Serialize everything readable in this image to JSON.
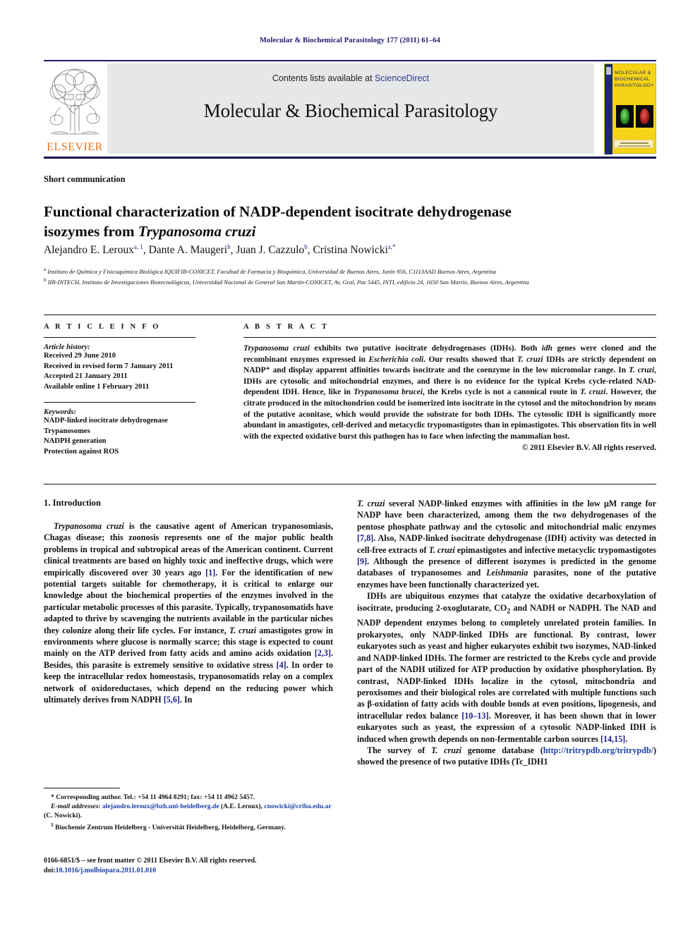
{
  "running_head": "Molecular & Biochemical Parasitology 177 (2011) 61–64",
  "masthead": {
    "publisher_name": "ELSEVIER",
    "contents_prefix": "Contents lists available at ",
    "sciencedirect": "ScienceDirect",
    "journal_title": "Molecular & Biochemical Parasitology",
    "cover_title": "MOLECULAR & BIOCHEMICAL PARASITOLOGY"
  },
  "article": {
    "doc_type": "Short communication",
    "title_line1": "Functional characterization of NADP-dependent isocitrate dehydrogenase",
    "title_line2_pre": "isozymes from ",
    "title_line2_italic": "Trypanosoma cruzi",
    "authors": [
      {
        "name": "Alejandro E. Leroux",
        "sup": "a, 1",
        "sep": ", "
      },
      {
        "name": "Dante A. Maugeri",
        "sup": "b",
        "sep": ", "
      },
      {
        "name": "Juan J. Cazzulo",
        "sup": "b",
        "sep": ", "
      },
      {
        "name": "Cristina Nowicki",
        "sup": "a,*",
        "sep": ""
      }
    ],
    "affiliations": [
      {
        "marker": "a",
        "text": "Instituto de Química y Fisicoquímica Biológica IQUIFIB-CONICET, Facultad de Farmacia y Bioquímica, Universidad de Buenos Aires, Junín 956, C1113AAD Buenos Aires, Argentina"
      },
      {
        "marker": "b",
        "text": "IIB-INTECH, Instituto de Investigaciones Biotecnológicas, Universidad Nacional de General San Martín-CONICET, Av, Gral, Paz 5445, INTI, edificio 24, 1650 San Martín, Buenos Aires, Argentina"
      }
    ]
  },
  "article_info": {
    "label": "A R T I C L E    I N F O",
    "history_title": "Article history:",
    "history": [
      "Received 29 June 2010",
      "Received in revised form 7 January 2011",
      "Accepted 21 January 2011",
      "Available online 1 February 2011"
    ],
    "keywords_title": "Keywords:",
    "keywords": [
      "NADP-linked isocitrate dehydrogenase",
      "Trypanosomes",
      "NADPH generation",
      "Protection against ROS"
    ]
  },
  "abstract": {
    "label": "A B S T R A C T",
    "copyright": "© 2011 Elsevier B.V. All rights reserved.",
    "parts": [
      {
        "type": "i",
        "text": "Trypanosoma cruzi"
      },
      {
        "type": "t",
        "text": " exhibits two putative isocitrate dehydrogenases (IDHs). Both "
      },
      {
        "type": "i",
        "text": "idh"
      },
      {
        "type": "t",
        "text": " genes were cloned and the recombinant enzymes expressed in "
      },
      {
        "type": "i",
        "text": "Escherichia coli"
      },
      {
        "type": "t",
        "text": ". Our results showed that "
      },
      {
        "type": "i",
        "text": "T. cruzi"
      },
      {
        "type": "t",
        "text": " IDHs are strictly dependent on NADP⁺ and display apparent affinities towards isocitrate and the coenzyme in the low micromolar range. In "
      },
      {
        "type": "i",
        "text": "T. cruzi"
      },
      {
        "type": "t",
        "text": ", IDHs are cytosolic and mitochondrial enzymes, and there is no evidence for the typical Krebs cycle-related NAD-dependent IDH. Hence, like in "
      },
      {
        "type": "i",
        "text": "Trypanosoma brucei"
      },
      {
        "type": "t",
        "text": ", the Krebs cycle is not a canonical route in "
      },
      {
        "type": "i",
        "text": "T. cruzi"
      },
      {
        "type": "t",
        "text": ". However, the citrate produced in the mitochondrion could be isomerized into isocitrate in the cytosol and the mitochondrion by means of the putative aconitase, which would provide the substrate for both IDHs. The cytosolic IDH is significantly more abundant in amastigotes, cell-derived and metacyclic trypomastigotes than in epimastigotes. This observation fits in well with the expected oxidative burst this pathogen has to face when infecting the mammalian host."
      }
    ]
  },
  "body": {
    "section_heading": "1.  Introduction",
    "left_paragraph_parts": [
      {
        "type": "i",
        "text": "Trypanosoma cruzi"
      },
      {
        "type": "t",
        "text": " is the causative agent of American trypanosomiasis, Chagas disease; this zoonosis represents one of the major public health problems in tropical and subtropical areas of the American continent. Current clinical treatments are based on highly toxic and ineffective drugs, which were empirically discovered over 30 years ago "
      },
      {
        "type": "r",
        "text": "[1]"
      },
      {
        "type": "t",
        "text": ". For the identification of new potential targets suitable for chemotherapy, it is critical to enlarge our knowledge about the biochemical properties of the enzymes involved in the particular metabolic processes of this parasite. Typically, trypanosomatids have adapted to thrive by scavenging the nutrients available in the particular niches they colonize along their life cycles. For instance, "
      },
      {
        "type": "i",
        "text": "T. cruzi"
      },
      {
        "type": "t",
        "text": " amastigotes grow in environments where glucose is normally scarce; this stage is expected to count mainly on the ATP derived from fatty acids and amino acids oxidation "
      },
      {
        "type": "r",
        "text": "[2,3]"
      },
      {
        "type": "t",
        "text": ". Besides, this parasite is extremely sensitive to oxidative stress "
      },
      {
        "type": "r",
        "text": "[4]"
      },
      {
        "type": "t",
        "text": ". In order to keep the intracellular redox homeostasis, trypanosomatids relay on a complex network of oxidoreductases, which depend on the reducing power which ultimately derives from NADPH "
      },
      {
        "type": "r",
        "text": "[5,6]"
      },
      {
        "type": "t",
        "text": ". In"
      }
    ],
    "right_paragraph1_parts": [
      {
        "type": "i",
        "text": "T. cruzi"
      },
      {
        "type": "t",
        "text": " several NADP-linked enzymes with affinities in the low μM range for NADP have been characterized, among them the two dehydrogenases of the pentose phosphate pathway and the cytosolic and mitochondrial malic enzymes "
      },
      {
        "type": "r",
        "text": "[7,8]"
      },
      {
        "type": "t",
        "text": ". Also, NADP-linked isocitrate dehydrogenase (IDH) activity was detected in cell-free extracts of "
      },
      {
        "type": "i",
        "text": "T. cruzi"
      },
      {
        "type": "t",
        "text": " epimastigotes and infective metacyclic trypomastigotes "
      },
      {
        "type": "r",
        "text": "[9]"
      },
      {
        "type": "t",
        "text": ". Although the presence of different isozymes is predicted in the genome databases of trypanosomes and "
      },
      {
        "type": "i",
        "text": "Leishmania"
      },
      {
        "type": "t",
        "text": " parasites, none of the putative enzymes have been functionally characterized yet."
      }
    ],
    "right_paragraph2_parts": [
      {
        "type": "t",
        "text": "IDHs are ubiquitous enzymes that catalyze the oxidative decarboxylation of isocitrate, producing 2-oxoglutarate, CO"
      },
      {
        "type": "sub",
        "text": "2"
      },
      {
        "type": "t",
        "text": " and NADH or NADPH. The NAD and NADP dependent enzymes belong to completely unrelated protein families. In prokaryotes, only NADP-linked IDHs are functional. By contrast, lower eukaryotes such as yeast and higher eukaryotes exhibit two isozymes, NAD-linked and NADP-linked IDHs. The former are restricted to the Krebs cycle and provide part of the NADH utilized for ATP production by oxidative phosphorylation. By contrast, NADP-linked IDHs localize in the cytosol, mitochondria and peroxisomes and their biological roles are correlated with multiple functions such as β-oxidation of fatty acids with double bonds at even positions, lipogenesis, and intracellular redox balance "
      },
      {
        "type": "r",
        "text": "[10–13]"
      },
      {
        "type": "t",
        "text": ". Moreover, it has been shown that in lower eukaryotes such as yeast, the expression of a cytosolic NADP-linked IDH is induced when growth depends on non-fermentable carbon sources "
      },
      {
        "type": "r",
        "text": "[14,15]"
      },
      {
        "type": "t",
        "text": "."
      }
    ],
    "right_paragraph3_parts": [
      {
        "type": "t",
        "text": "The survey of "
      },
      {
        "type": "i",
        "text": "T. cruzi"
      },
      {
        "type": "t",
        "text": " genome database ("
      },
      {
        "type": "l",
        "text": "http://tritrypdb.org/tritrypdb/"
      },
      {
        "type": "t",
        "text": ") showed the presence of two putative IDHs (Tc_IDH1"
      }
    ]
  },
  "footnotes": {
    "corresponding": "* Corresponding author. Tel.: +54 11 4964 8291; fax: +54 11 4962 5457.",
    "email_label": "E-mail addresses:",
    "email1": "alejandro.leroux@bzh.uni-heidelberg.de",
    "email1_who": " (A.E. Leroux),",
    "email2": "cnowicki@criba.edu.ar",
    "email2_who": " (C. Nowicki).",
    "note_marker": "1",
    "note_text": " Biochemie Zentrum Heidelberg - Universität Heidelberg, Heidelberg, Germany."
  },
  "imprint": {
    "issn_line": "0166-6851/$ – see front matter © 2011 Elsevier B.V. All rights reserved.",
    "doi_label": "doi:",
    "doi_value": "10.1016/j.molbiopara.2011.01.010"
  },
  "colors": {
    "link_blue": "#1a3faa",
    "ref_blue": "#1a1a8c",
    "running_head_blue": "#1a1a6e",
    "elsevier_orange": "#E8711A",
    "cover_yellow": "#F5D317",
    "banner_gray": "#e6e7e8"
  }
}
